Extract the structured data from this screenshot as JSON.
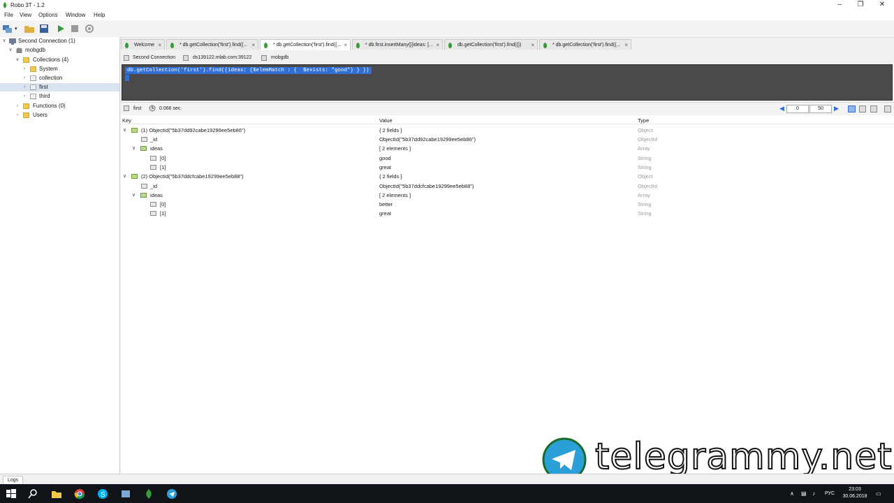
{
  "window": {
    "title": "Robo 3T - 1.2"
  },
  "menu": [
    "File",
    "View",
    "Options",
    "Window",
    "Help"
  ],
  "sidebar": {
    "connection": "Second Connection (1)",
    "database": "mobgdb",
    "collections_label": "Collections (4)",
    "collections": [
      "System",
      "collection",
      "first",
      "third"
    ],
    "functions": "Functions (0)",
    "users": "Users"
  },
  "tabs": [
    {
      "label": "Welcome"
    },
    {
      "label": "* db.getCollection('first').find({..."
    },
    {
      "label": "* db.getCollection('first').find({..."
    },
    {
      "label": "* db.first.insertMany([{ideas: [..."
    },
    {
      "label": "db.getCollection('first').find({})"
    },
    {
      "label": "* db.getCollection('first').find({..."
    }
  ],
  "connection_info": {
    "connection": "Second Connection",
    "host": "ds139122.mlab.com:39122",
    "db": "mobgdb"
  },
  "editor": {
    "query": "db.getCollection('first').find({ideas: {$elemMatch : {  $exists: \"good\"} } })"
  },
  "result": {
    "collection": "first",
    "time": "0.066 sec.",
    "page_start": "0",
    "page_size": "50"
  },
  "columns": {
    "key": "Key",
    "value": "Value",
    "type": "Type"
  },
  "rows": [
    {
      "key": "(1) ObjectId(\"5b37dd92cabe19299ee5eb86\")",
      "value": "{ 2 fields }",
      "type": "Object"
    },
    {
      "key": "_id",
      "value": "ObjectId(\"5b37dd92cabe19299ee5eb86\")",
      "type": "ObjectId"
    },
    {
      "key": "ideas",
      "value": "[ 2 elements ]",
      "type": "Array"
    },
    {
      "key": "[0]",
      "value": "good",
      "type": "String"
    },
    {
      "key": "[1]",
      "value": "great",
      "type": "String"
    },
    {
      "key": "(2) ObjectId(\"5b37ddcfcabe19299ee5eb88\")",
      "value": "{ 2 fields }",
      "type": "Object"
    },
    {
      "key": "_id",
      "value": "ObjectId(\"5b37ddcfcabe19299ee5eb88\")",
      "type": "ObjectId"
    },
    {
      "key": "ideas",
      "value": "[ 2 elements ]",
      "type": "Array"
    },
    {
      "key": "[0]",
      "value": "better",
      "type": "String"
    },
    {
      "key": "[1]",
      "value": "great",
      "type": "String"
    }
  ],
  "status": {
    "logs": "Logs"
  },
  "taskbar": {
    "lang": "РУС",
    "time": "23:03",
    "date": "30.06.2018"
  },
  "watermark": {
    "text": "telegrammy.net"
  }
}
